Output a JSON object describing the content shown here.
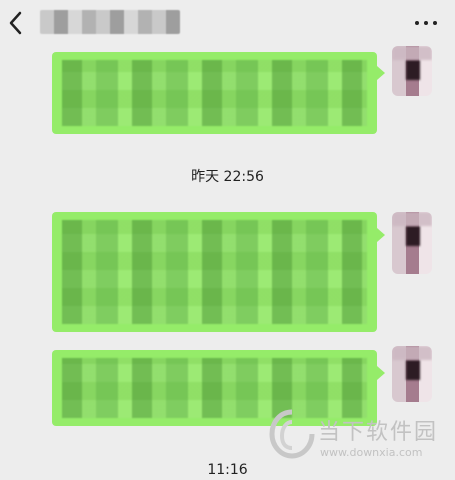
{
  "theme": {
    "background": "#ededed",
    "bubble_color": "#95ec69"
  },
  "topbar": {
    "back_icon": "chevron-left-icon",
    "title": "",
    "more_icon": "more-dots-icon"
  },
  "messages": [
    {
      "id": 1,
      "sender": "self",
      "text": ""
    },
    {
      "id": 2,
      "sender": "self",
      "text": ""
    },
    {
      "id": 3,
      "sender": "self",
      "text": ""
    }
  ],
  "timestamps": {
    "first": "昨天 22:56",
    "second": "11:16"
  },
  "watermark": {
    "cn": "当下软件园",
    "url": "www.downxia.com"
  }
}
